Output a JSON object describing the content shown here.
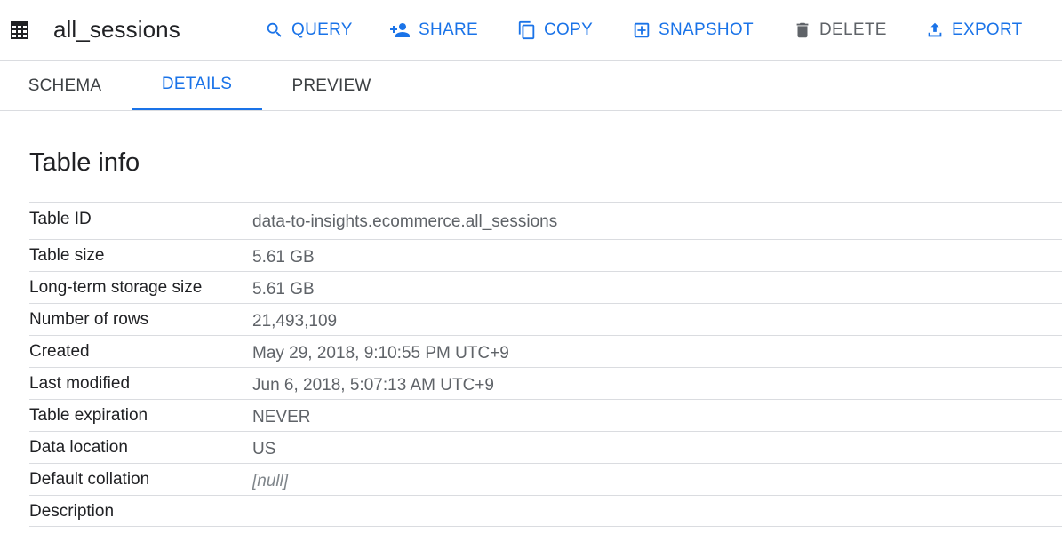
{
  "header": {
    "title": "all_sessions",
    "actions": {
      "query": "QUERY",
      "share": "SHARE",
      "copy": "COPY",
      "snapshot": "SNAPSHOT",
      "delete": "DELETE",
      "export": "EXPORT"
    }
  },
  "tabs": {
    "schema": "SCHEMA",
    "details": "DETAILS",
    "preview": "PREVIEW",
    "active": "DETAILS"
  },
  "section": {
    "title": "Table info"
  },
  "table_info": [
    {
      "label": "Table ID",
      "value": "data-to-insights.ecommerce.all_sessions"
    },
    {
      "label": "Table size",
      "value": "5.61 GB"
    },
    {
      "label": "Long-term storage size",
      "value": "5.61 GB"
    },
    {
      "label": "Number of rows",
      "value": "21,493,109"
    },
    {
      "label": "Created",
      "value": "May 29, 2018, 9:10:55 PM UTC+9"
    },
    {
      "label": "Last modified",
      "value": "Jun 6, 2018, 5:07:13 AM UTC+9"
    },
    {
      "label": "Table expiration",
      "value": "NEVER"
    },
    {
      "label": "Data location",
      "value": "US"
    },
    {
      "label": "Default collation",
      "value": "[null]"
    },
    {
      "label": "Description",
      "value": ""
    }
  ],
  "colors": {
    "accent": "#1a73e8",
    "text": "#202124",
    "secondary_text": "#5f6368",
    "divider": "#dadce0"
  },
  "icons": {
    "table": "table-grid-icon",
    "query": "search-icon",
    "share": "person-add-icon",
    "copy": "copy-icon",
    "snapshot": "snapshot-icon",
    "delete": "trash-icon",
    "export": "upload-icon"
  }
}
